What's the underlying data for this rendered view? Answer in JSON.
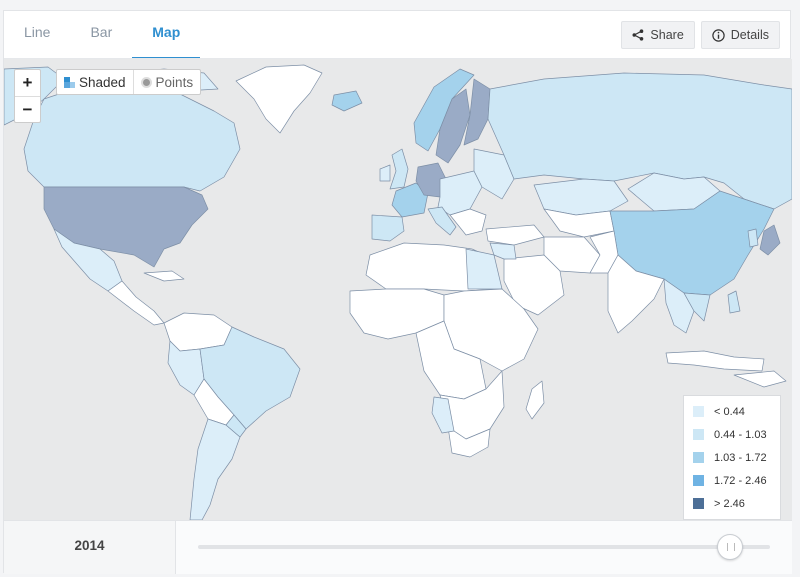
{
  "tabs": [
    {
      "label": "Line",
      "active": false
    },
    {
      "label": "Bar",
      "active": false
    },
    {
      "label": "Map",
      "active": true
    }
  ],
  "tools": {
    "share_label": "Share",
    "details_label": "Details",
    "share_icon": "share-icon",
    "details_icon": "info-icon"
  },
  "map_controls": {
    "zoom_in": "+",
    "zoom_out": "−",
    "shaded_label": "Shaded",
    "points_label": "Points",
    "active_mode": "Shaded"
  },
  "legend": [
    {
      "label": "< 0.44",
      "color": "#dceef9"
    },
    {
      "label": "0.44 - 1.03",
      "color": "#cde7f5"
    },
    {
      "label": "1.03 - 1.72",
      "color": "#a4d2ec"
    },
    {
      "label": "1.72 - 2.46",
      "color": "#6fb3e3"
    },
    {
      "label": "> 2.46",
      "color": "#4d6f97"
    }
  ],
  "timeline": {
    "year": "2014",
    "position_fraction": 0.95
  },
  "colors": {
    "accent": "#2f8fd0",
    "ocean": "#e8e9ea",
    "no_data": "#ffffff",
    "highlight_dark": "#9aabc6"
  }
}
